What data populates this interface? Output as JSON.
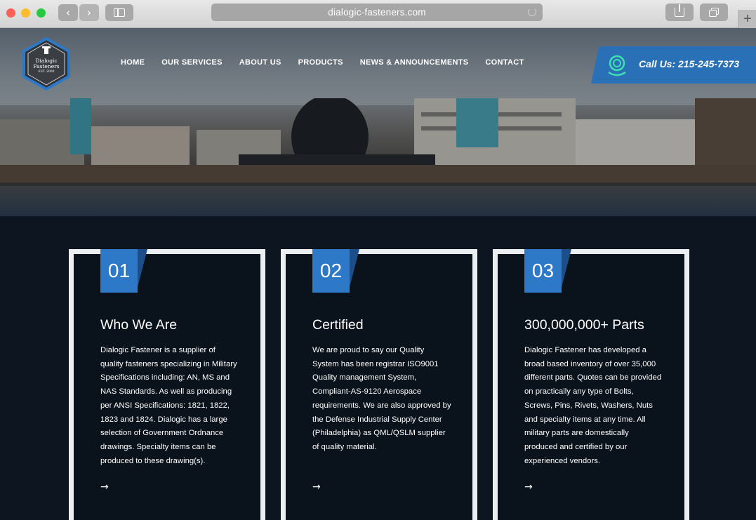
{
  "browser": {
    "url": "dialogic-fasteners.com",
    "back_icon": "‹",
    "forward_icon": "›",
    "new_tab_icon": "+"
  },
  "logo": {
    "name_line1": "Dialogic",
    "name_line2": "Fasteners",
    "sub": "EST. 2000"
  },
  "nav": {
    "items": [
      "HOME",
      "OUR SERVICES",
      "ABOUT US",
      "PRODUCTS",
      "NEWS & ANNOUNCEMENTS",
      "CONTACT"
    ]
  },
  "call": {
    "label": "Call Us: 215-245-7373",
    "accent": "#2a70b6"
  },
  "cards": [
    {
      "number": "01",
      "title": "Who We Are",
      "body": "Dialogic Fastener is a supplier of quality fasteners specializing in Military Specifications including: AN, MS and NAS Standards. As well as producing per ANSI Specifications: 1821, 1822, 1823 and 1824. Dialogic has a large selection of Government Ordnance drawings. Specialty items can be produced to these drawing(s).",
      "arrow": "→"
    },
    {
      "number": "02",
      "title": "Certified",
      "body": "We are proud to say our Quality System has been registrar ISO9001 Quality management System, Compliant-AS-9120 Aerospace requirements. We are also approved by the Defense Industrial Supply Center (Philadelphia) as QML/QSLM supplier of quality material.",
      "arrow": "→"
    },
    {
      "number": "03",
      "title": "300,000,000+ Parts",
      "body": "Dialogic Fastener has developed a broad based inventory of over 35,000 different parts. Quotes can be provided on practically any type of Bolts, Screws, Pins, Rivets, Washers, Nuts and specialty items at any time. All military parts are domestically produced and certified by our experienced vendors.",
      "arrow": "→"
    }
  ]
}
